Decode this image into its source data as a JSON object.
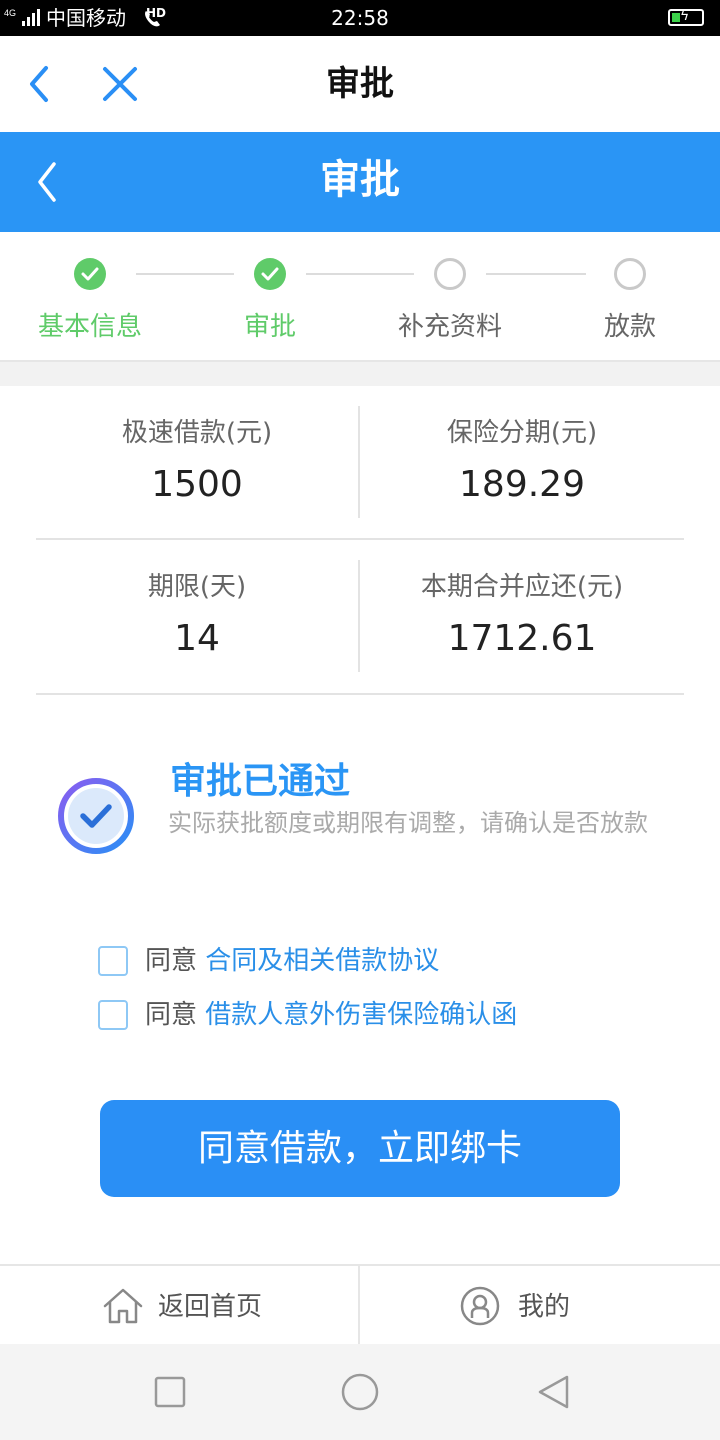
{
  "status_bar": {
    "carrier": "中国移动",
    "network": "4G",
    "hd": "HD",
    "time": "22:58"
  },
  "top_nav": {
    "title": "审批"
  },
  "header": {
    "title": "审批",
    "color": "#2a95f5"
  },
  "steps": [
    {
      "label": "基本信息",
      "state": "done"
    },
    {
      "label": "审批",
      "state": "done"
    },
    {
      "label": "补充资料",
      "state": "todo"
    },
    {
      "label": "放款",
      "state": "todo"
    }
  ],
  "loan_info": {
    "amount_label": "极速借款(元)",
    "amount_value": "1500",
    "insurance_label": "保险分期(元)",
    "insurance_value": "189.29",
    "term_label": "期限(天)",
    "term_value": "14",
    "repay_label": "本期合并应还(元)",
    "repay_value": "1712.61"
  },
  "approval": {
    "title": "审批已通过",
    "description": "实际获批额度或期限有调整，请确认是否放款"
  },
  "agreements": [
    {
      "prefix": "同意",
      "link": "合同及相关借款协议",
      "checked": false
    },
    {
      "prefix": "同意",
      "link": "借款人意外伤害保险确认函",
      "checked": false
    }
  ],
  "cta": {
    "label": "同意借款，立即绑卡"
  },
  "tab_bar": {
    "home_label": "返回首页",
    "mine_label": "我的"
  }
}
